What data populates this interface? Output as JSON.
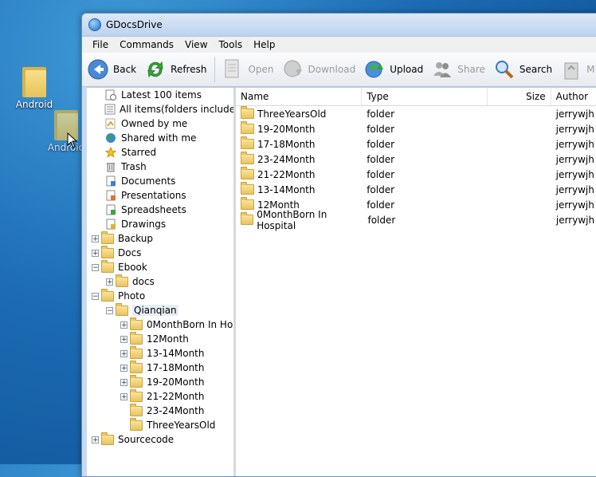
{
  "desktop": {
    "icons": [
      {
        "label": "Android"
      },
      {
        "label": "Android"
      }
    ]
  },
  "window": {
    "title": "GDocsDrive"
  },
  "menu": [
    "File",
    "Commands",
    "View",
    "Tools",
    "Help"
  ],
  "toolbar": {
    "back": "Back",
    "refresh": "Refresh",
    "open": "Open",
    "download": "Download",
    "upload": "Upload",
    "share": "Share",
    "search": "Search",
    "more": "M"
  },
  "tree": {
    "latest": "Latest 100 items",
    "all_items": "All items(folders included",
    "owned": "Owned by me",
    "shared": "Shared with me",
    "starred": "Starred",
    "trash": "Trash",
    "documents": "Documents",
    "presentations": "Presentations",
    "spreadsheets": "Spreadsheets",
    "drawings": "Drawings",
    "backup": "Backup",
    "docs": "Docs",
    "ebook": "Ebook",
    "ebook_docs": "docs",
    "photo": "Photo",
    "qianqian": "Qianqian",
    "q0": "0MonthBorn In Ho",
    "q1": "12Month",
    "q2": "13-14Month",
    "q3": "17-18Month",
    "q4": "19-20Month",
    "q5": "21-22Month",
    "q6": "23-24Month",
    "q7": "ThreeYearsOld",
    "sourcecode": "Sourcecode"
  },
  "list": {
    "columns": {
      "name": "Name",
      "type": "Type",
      "size": "Size",
      "author": "Author"
    },
    "rows": [
      {
        "name": "ThreeYearsOld",
        "type": "folder",
        "size": "",
        "author": "jerrywjh"
      },
      {
        "name": "19-20Month",
        "type": "folder",
        "size": "",
        "author": "jerrywjh"
      },
      {
        "name": "17-18Month",
        "type": "folder",
        "size": "",
        "author": "jerrywjh"
      },
      {
        "name": "23-24Month",
        "type": "folder",
        "size": "",
        "author": "jerrywjh"
      },
      {
        "name": "21-22Month",
        "type": "folder",
        "size": "",
        "author": "jerrywjh"
      },
      {
        "name": "13-14Month",
        "type": "folder",
        "size": "",
        "author": "jerrywjh"
      },
      {
        "name": "12Month",
        "type": "folder",
        "size": "",
        "author": "jerrywjh"
      },
      {
        "name": "0MonthBorn In Hospital",
        "type": "folder",
        "size": "",
        "author": "jerrywjh"
      }
    ]
  }
}
